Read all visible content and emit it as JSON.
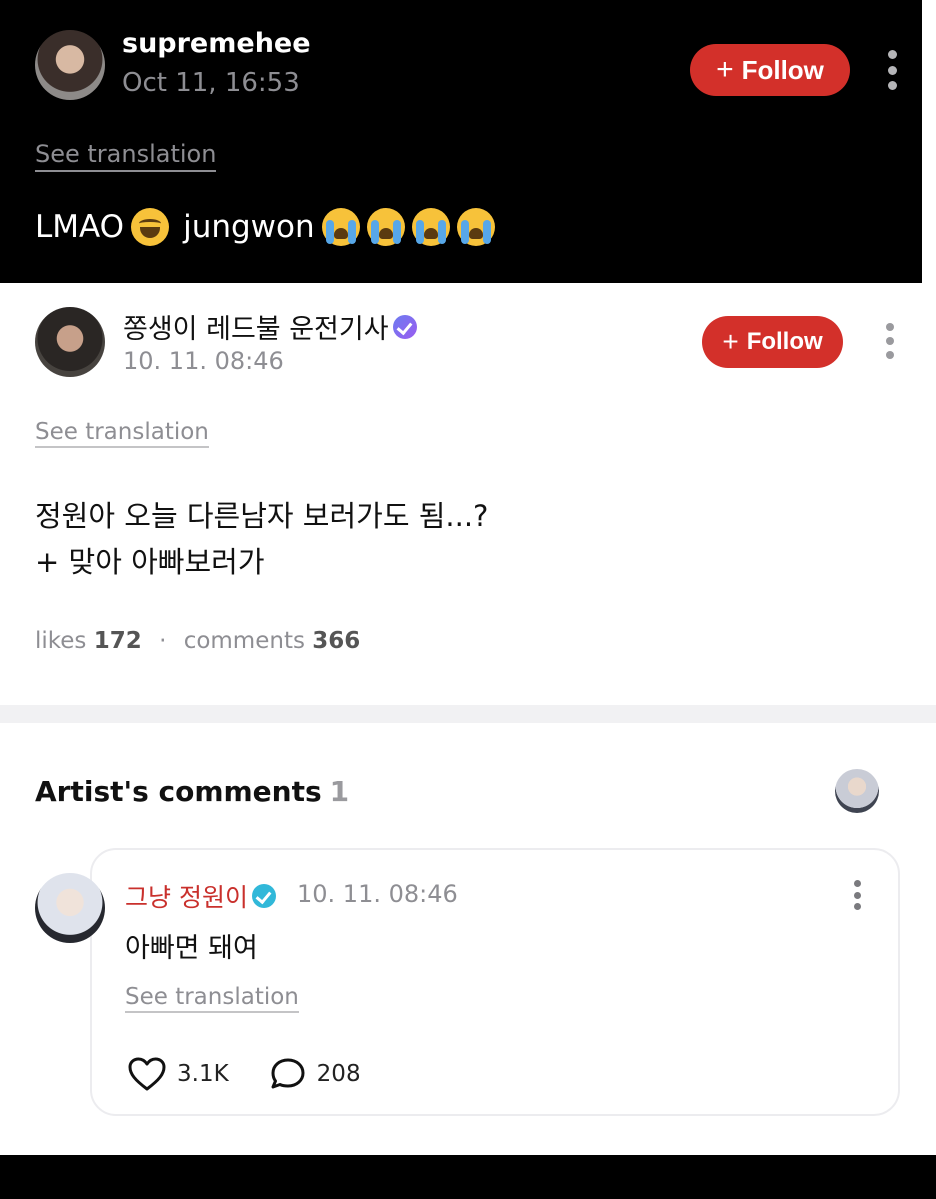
{
  "top_post": {
    "username": "supremehee",
    "date": "Oct 11, 16:53",
    "follow_label": "Follow",
    "see_translation": "See translation",
    "text_before": "LMAO",
    "text_after": "jungwon"
  },
  "main_post": {
    "username": "쫑생이 레드불 운전기사",
    "date": "10. 11. 08:46",
    "follow_label": "Follow",
    "see_translation": "See translation",
    "body_line1": "정원아 오늘 다른남자 보러가도 됨...?",
    "body_line2": "+ 맞아 아빠보러가",
    "likes_label": "likes",
    "likes_value": "172",
    "comments_label": "comments",
    "comments_value": "366",
    "separator": "·"
  },
  "artist_comments": {
    "title": "Artist's comments",
    "count": "1",
    "comment": {
      "username": "그냥 정원이",
      "date": "10. 11. 08:46",
      "body": "아빠면 돼여",
      "see_translation": "See translation",
      "likes": "3.1K",
      "replies": "208"
    }
  },
  "colors": {
    "follow_button": "#d3302a",
    "artist_name": "#c9302c",
    "verified_badge_purple": "#7b6cf0",
    "verified_badge_teal": "#31b8d9"
  },
  "icons": {
    "more": "kebab-vertical-icon",
    "plus": "plus-icon",
    "like": "heart-outline-icon",
    "reply": "speech-bubble-icon",
    "verified": "verified-check-icon"
  }
}
